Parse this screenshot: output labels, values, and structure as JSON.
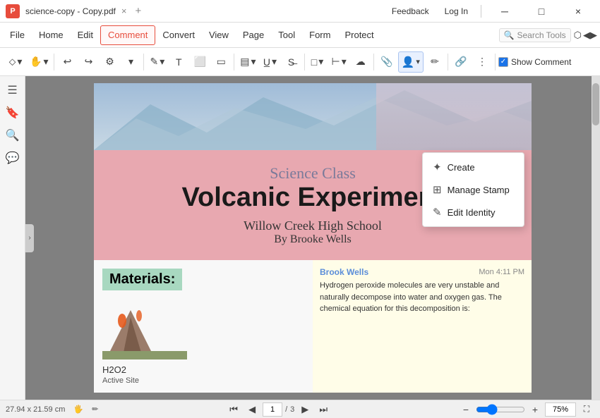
{
  "titlebar": {
    "app_icon": "P",
    "title": "science-copy - Copy.pdf",
    "close_tab": "×",
    "new_tab": "+",
    "feedback": "Feedback",
    "login": "Log In",
    "minimize": "─",
    "maximize": "□",
    "close": "×"
  },
  "menubar": {
    "items": [
      "File",
      "Home",
      "Edit",
      "Comment",
      "Convert",
      "View",
      "Page",
      "Tool",
      "Form",
      "Protect"
    ],
    "active": "Comment",
    "search_placeholder": "Search Tools"
  },
  "toolbar": {
    "show_comment": "Show Comment"
  },
  "pdf": {
    "title_sub": "Science Class",
    "title_main": "Volcanic Experiment",
    "school": "Willow Creek High School",
    "author": "By Brooke Wells",
    "materials_label": "Materials:",
    "material1": "H2O2",
    "material2": "Active Site",
    "note_author": "Brook Wells",
    "note_time": "Mon 4:11 PM",
    "note_text": "Hydrogen peroxide molecules are very unstable and naturally decompose into water and oxygen gas. The chemical equation for this decomposition is:"
  },
  "bottombar": {
    "dimensions": "27.94 x 21.59 cm",
    "page_current": "1",
    "page_total": "3",
    "zoom_level": "75%"
  },
  "dropdown": {
    "items": [
      {
        "label": "Create",
        "icon": "+"
      },
      {
        "label": "Manage Stamp",
        "icon": "⊞"
      },
      {
        "label": "Edit Identity",
        "icon": "✎"
      }
    ]
  }
}
